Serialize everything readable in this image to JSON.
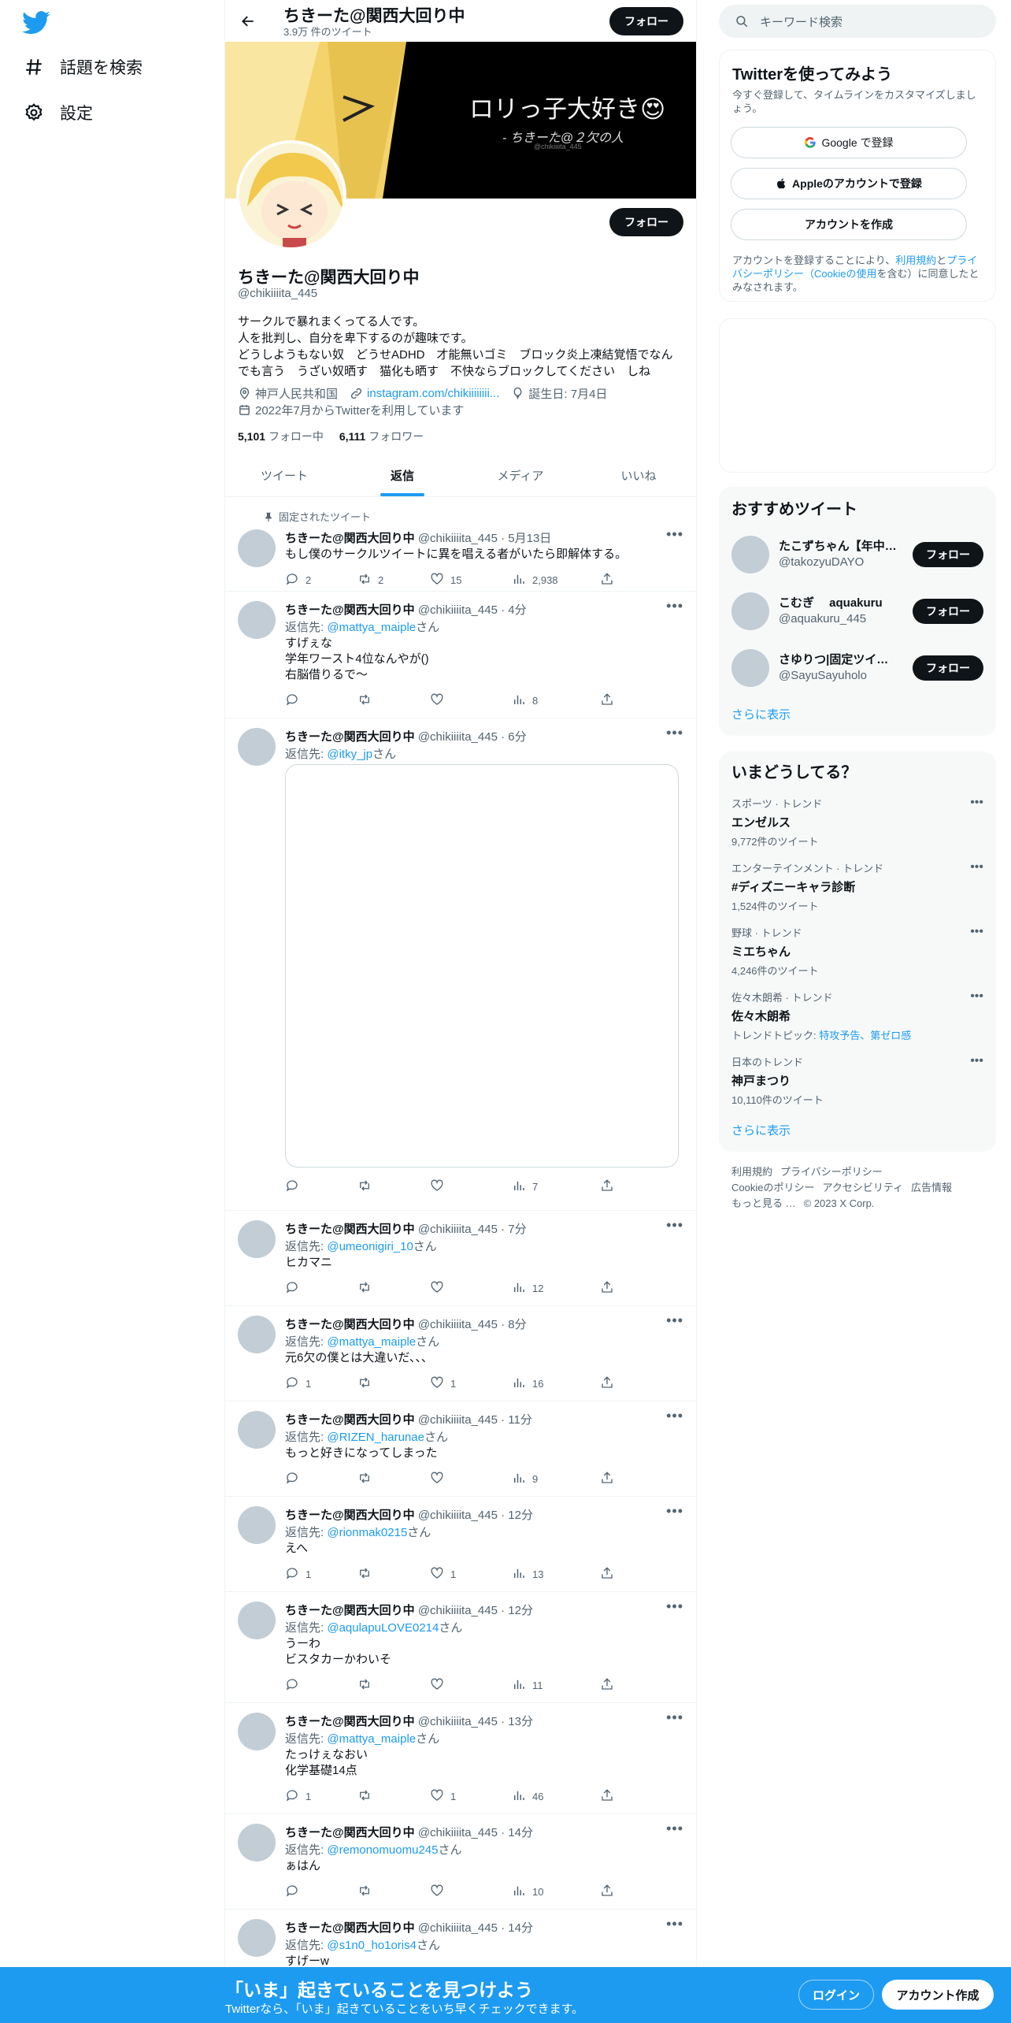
{
  "nav": {
    "logo": "twitter-bird",
    "items": [
      {
        "label": "話題を検索",
        "icon": "hashtag-icon"
      },
      {
        "label": "設定",
        "icon": "gear-icon"
      }
    ]
  },
  "header": {
    "name": "ちきーた@関西大回り中",
    "tweet_count": "3.9万 件のツイート",
    "follow_label": "フォロー"
  },
  "banner": {
    "text": "ロリっ子大好き😍",
    "subtext": "- ちきーた@２欠の人",
    "watermark": "@chikiiiita_445"
  },
  "profile": {
    "follow_label": "フォロー",
    "name": "ちきーた@関西大回り中",
    "handle": "@chikiiiita_445",
    "bio": [
      "サークルで暴れまくってる人です。",
      "人を批判し、自分を卑下するのが趣味です。",
      "どうしようもない奴　どうせADHD　才能無いゴミ　ブロック炎上凍結覚悟でなん",
      "でも言う　うざい奴晒す　猫化も晒す　不快ならブロックしてください　しね"
    ],
    "location": "神戸人民共和国",
    "website": "instagram.com/chikiiiiiiii...",
    "birthday": "誕生日: 7月4日",
    "joined": "2022年7月からTwitterを利用しています",
    "following_count": "5,101",
    "following_label": "フォロー中",
    "followers_count": "6,111",
    "followers_label": "フォロワー"
  },
  "tabs": [
    {
      "label": "ツイート",
      "active": false
    },
    {
      "label": "返信",
      "active": true
    },
    {
      "label": "メディア",
      "active": false
    },
    {
      "label": "いいね",
      "active": false
    }
  ],
  "tweets": [
    {
      "pinned_label": "固定されたツイート",
      "name": "ちきーた@関西大回り中",
      "meta": "@chikiiiita_445 · 5月13日",
      "reply_prefix": "",
      "reply_to": "",
      "reply_suffix": "",
      "lines": [
        "もし僕のサークルツイートに異を唱える者がいたら即解体する。"
      ],
      "replies": "2",
      "retweets": "2",
      "likes": "15",
      "views": "2,938"
    },
    {
      "name": "ちきーた@関西大回り中",
      "meta": "@chikiiiita_445 · 4分",
      "reply_prefix": "返信先: ",
      "reply_to": "@mattya_maiple",
      "reply_suffix": "さん",
      "lines": [
        "すげぇな",
        "学年ワースト4位なんやが()",
        "右脳借りるで〜"
      ],
      "replies": "",
      "retweets": "",
      "likes": "",
      "views": "8"
    },
    {
      "name": "ちきーた@関西大回り中",
      "meta": "@chikiiiita_445 · 6分",
      "reply_prefix": "返信先: ",
      "reply_to": "@itky_jp",
      "reply_suffix": "さん",
      "lines": [],
      "replies": "",
      "retweets": "",
      "likes": "",
      "views": "7"
    },
    {
      "name": "ちきーた@関西大回り中",
      "meta": "@chikiiiita_445 · 7分",
      "reply_prefix": "返信先: ",
      "reply_to": "@umeonigiri_10",
      "reply_suffix": "さん",
      "lines": [
        "ヒカマニ"
      ],
      "replies": "",
      "retweets": "",
      "likes": "",
      "views": "12"
    },
    {
      "name": "ちきーた@関西大回り中",
      "meta": "@chikiiiita_445 · 8分",
      "reply_prefix": "返信先: ",
      "reply_to": "@mattya_maiple",
      "reply_suffix": "さん",
      "lines": [
        "元6欠の僕とは大違いだ、、、"
      ],
      "replies": "1",
      "retweets": "",
      "likes": "1",
      "views": "16"
    },
    {
      "name": "ちきーた@関西大回り中",
      "meta": "@chikiiiita_445 · 11分",
      "reply_prefix": "返信先: ",
      "reply_to": "@RIZEN_harunae",
      "reply_suffix": "さん",
      "lines": [
        "もっと好きになってしまった"
      ],
      "replies": "",
      "retweets": "",
      "likes": "",
      "views": "9"
    },
    {
      "name": "ちきーた@関西大回り中",
      "meta": "@chikiiiita_445 · 12分",
      "reply_prefix": "返信先: ",
      "reply_to": "@rionmak0215",
      "reply_suffix": "さん",
      "lines": [
        "えへ"
      ],
      "replies": "1",
      "retweets": "",
      "likes": "1",
      "views": "13"
    },
    {
      "name": "ちきーた@関西大回り中",
      "meta": "@chikiiiita_445 · 12分",
      "reply_prefix": "返信先: ",
      "reply_to": "@aqulapuLOVE0214",
      "reply_suffix": "さん",
      "lines": [
        "うーわ",
        "ビスタカーかわいそ"
      ],
      "replies": "",
      "retweets": "",
      "likes": "",
      "views": "11"
    },
    {
      "name": "ちきーた@関西大回り中",
      "meta": "@chikiiiita_445 · 13分",
      "reply_prefix": "返信先: ",
      "reply_to": "@mattya_maiple",
      "reply_suffix": "さん",
      "lines": [
        "たっけぇなおい",
        "化学基礎14点"
      ],
      "replies": "1",
      "retweets": "",
      "likes": "1",
      "views": "46"
    },
    {
      "name": "ちきーた@関西大回り中",
      "meta": "@chikiiiita_445 · 14分",
      "reply_prefix": "返信先: ",
      "reply_to": "@remonomuomu245",
      "reply_suffix": "さん",
      "lines": [
        "ぁはん"
      ],
      "replies": "",
      "retweets": "",
      "likes": "",
      "views": "10"
    },
    {
      "name": "ちきーた@関西大回り中",
      "meta": "@chikiiiita_445 · 14分",
      "reply_prefix": "返信先: ",
      "reply_to": "@s1n0_ho1oris4",
      "reply_suffix": "さん",
      "lines": [
        "すげーw"
      ],
      "replies": "",
      "retweets": "",
      "likes": "",
      "views": ""
    }
  ],
  "right": {
    "search_placeholder": "キーワード検索",
    "signup": {
      "title": "Twitterを使ってみよう",
      "subtitle": "今すぐ登録して、タイムラインをカスタマイズしましょう。",
      "google_btn": "Google で登録",
      "apple_btn": "Appleのアカウントで登録",
      "create_btn": "アカウントを作成",
      "terms_1": "アカウントを登録することにより、",
      "terms_link1": "利用規約",
      "terms_2": "と",
      "terms_link2": "プライバシーポリシー（Cookieの使用",
      "terms_3": "を含む）に同意したとみなされます。"
    },
    "recommend": {
      "title": "おすすめツイート",
      "users": [
        {
          "name": "たこずちゃん【年中…",
          "handle": "@takozyuDAYO"
        },
        {
          "name": "こむぎ　 aquakuru",
          "handle": "@aquakuru_445"
        },
        {
          "name": "さゆりつ|固定ツイふ…",
          "handle": "@SayuSayuholo"
        }
      ],
      "follow_label": "フォロー",
      "more": "さらに表示"
    },
    "trends": {
      "title": "いまどうしてる？",
      "items": [
        {
          "context": "スポーツ · トレンド",
          "name": "エンゼルス",
          "count": "9,772件のツイート",
          "topics_label": "",
          "topics": ""
        },
        {
          "context": "エンターテインメント · トレンド",
          "name": "#ディズニーキャラ診断",
          "count": "1,524件のツイート",
          "topics_label": "",
          "topics": ""
        },
        {
          "context": "野球 · トレンド",
          "name": "ミエちゃん",
          "count": "4,246件のツイート",
          "topics_label": "",
          "topics": ""
        },
        {
          "context": "佐々木朗希 · トレンド",
          "name": "佐々木朗希",
          "count": "",
          "topics_label": "トレンドトピック: ",
          "topics": "特攻予告、第ゼロ感"
        },
        {
          "context": "日本のトレンド",
          "name": "神戸まつり",
          "count": "10,110件のツイート",
          "topics_label": "",
          "topics": ""
        }
      ],
      "more": "さらに表示"
    },
    "footer": [
      "利用規約",
      "プライバシーポリシー",
      "Cookieのポリシー",
      "アクセシビリティ",
      "広告情報",
      "もっと見る …",
      "© 2023 X Corp."
    ]
  },
  "bottom_bar": {
    "title": "「いま」起きていることを見つけよう",
    "subtitle": "Twitterなら、「いま」起きていることをいち早くチェックできます。",
    "login": "ログイン",
    "signup": "アカウント作成"
  },
  "colors": {
    "accent": "#1d9bf0",
    "text": "#0f1419",
    "muted": "#536471",
    "bottom_bar": "#1d9bf0"
  }
}
